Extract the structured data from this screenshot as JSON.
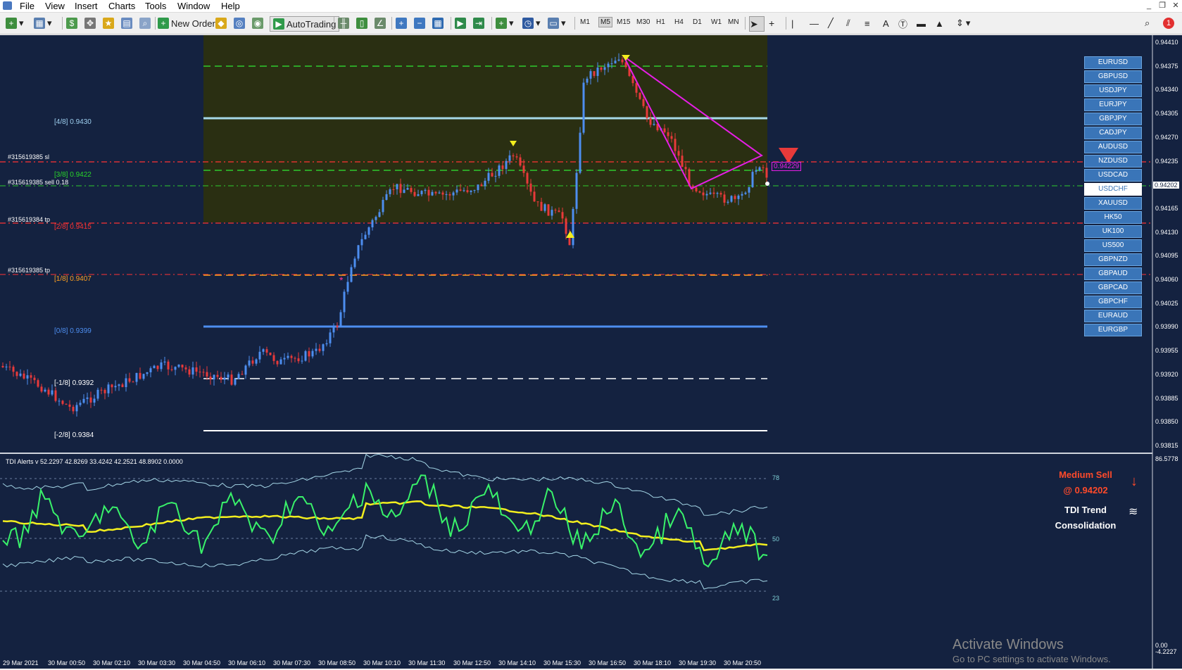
{
  "menu": {
    "items": [
      "File",
      "View",
      "Insert",
      "Charts",
      "Tools",
      "Window",
      "Help"
    ]
  },
  "window_controls": [
    "_",
    "❐",
    "✕"
  ],
  "toolbar": {
    "new_order": "New Order",
    "autotrading": "AutoTrading",
    "timeframes": [
      "M1",
      "M5",
      "M15",
      "M30",
      "H1",
      "H4",
      "D1",
      "W1",
      "MN"
    ],
    "notifications": "1"
  },
  "price_scale": [
    "0.94410",
    "0.94375",
    "0.94340",
    "0.94305",
    "0.94270",
    "0.94235",
    "0.94202",
    "0.94165",
    "0.94130",
    "0.94095",
    "0.94060",
    "0.94025",
    "0.93990",
    "0.93955",
    "0.93920",
    "0.93885",
    "0.93850",
    "0.93815"
  ],
  "pairs": [
    "EURUSD",
    "GBPUSD",
    "USDJPY",
    "EURJPY",
    "GBPJPY",
    "CADJPY",
    "AUDUSD",
    "NZDUSD",
    "USDCAD",
    "USDCHF",
    "XAUUSD",
    "HK50",
    "UK100",
    "US500",
    "GBPNZD",
    "GBPAUD",
    "GBPCAD",
    "GBPCHF",
    "EURAUD",
    "EURGBP"
  ],
  "active_pair": "USDCHF",
  "murrey": [
    {
      "tag": "[4/8]",
      "price": "0.9430",
      "color": "#9fd0f0"
    },
    {
      "tag": "[3/8]",
      "price": "0.9422",
      "color": "#29d629"
    },
    {
      "tag": "[2/8]",
      "price": "0.9415",
      "color": "#ff3333"
    },
    {
      "tag": "[1/8]",
      "price": "0.9407",
      "color": "#ffa020"
    },
    {
      "tag": "[0/8]",
      "price": "0.9399",
      "color": "#4d8ef0"
    },
    {
      "tag": "[-1/8]",
      "price": "0.9392",
      "color": "#ffffff"
    },
    {
      "tag": "[-2/8]",
      "price": "0.9384",
      "color": "#ffffff"
    }
  ],
  "orders": [
    "#315619385 sl",
    "#315619385 sell 0.18",
    "#315619384 tp",
    "#315619385 tp"
  ],
  "pattern_label": "0.94229",
  "tdi": {
    "caption": "TDI Alerts v 52.2297 42.8269 33.4242 42.2521 48.8902 0.0000",
    "levels": [
      "78",
      "50",
      "23"
    ],
    "scale_top": "86.5778",
    "scale_bottom": "0.00",
    "scale_bottom2": "-4.2227"
  },
  "signal": {
    "line1": "Medium Sell",
    "line2": "@ 0.94202",
    "trend_label": "TDI Trend",
    "trend_value": "Consolidation"
  },
  "time_labels": [
    "29 Mar 2021",
    "30 Mar 00:50",
    "30 Mar 02:10",
    "30 Mar 03:30",
    "30 Mar 04:50",
    "30 Mar 06:10",
    "30 Mar 07:30",
    "30 Mar 08:50",
    "30 Mar 10:10",
    "30 Mar 11:30",
    "30 Mar 12:50",
    "30 Mar 14:10",
    "30 Mar 15:30",
    "30 Mar 16:50",
    "30 Mar 18:10",
    "30 Mar 19:30",
    "30 Mar 20:50"
  ],
  "watermark": {
    "title": "Activate Windows",
    "subtitle": "Go to PC settings to activate Windows."
  },
  "colors": {
    "background": "#142240",
    "bull": "#4d8ef0",
    "bear": "#e83a3a",
    "rsi": "#39f26a",
    "signal_line": "#f2ee1e",
    "band": "#a6d8e8",
    "pattern": "#e61ee6"
  }
}
